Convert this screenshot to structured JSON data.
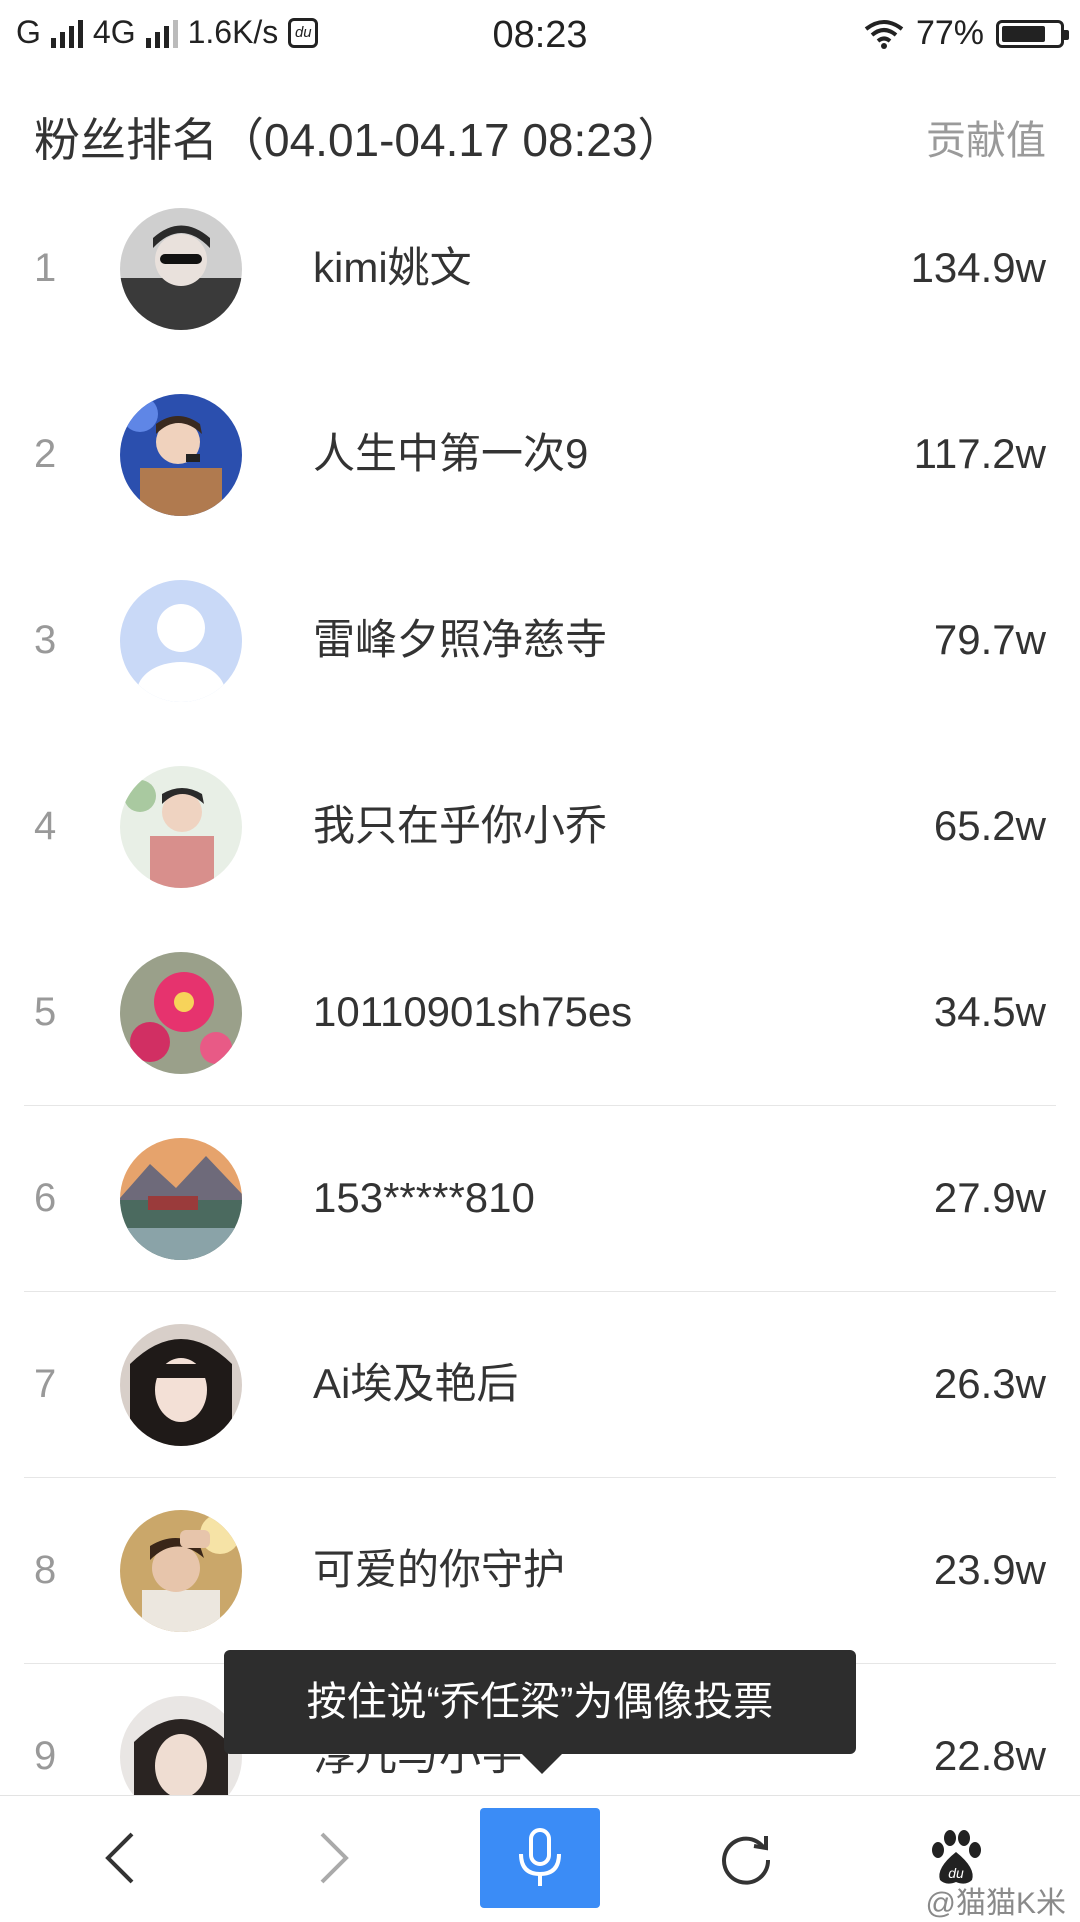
{
  "status_bar": {
    "carrier": "G",
    "network": "4G",
    "speed": "1.6K/s",
    "time": "08:23",
    "battery": "77%",
    "battery_level": 0.77
  },
  "header": {
    "title": "粉丝排名（04.01-04.17 08:23）",
    "column_label": "贡献值"
  },
  "fans": [
    {
      "rank": "1",
      "name": "kimi姚文",
      "score": "134.9w",
      "avatar": "photo-man-sunglasses"
    },
    {
      "rank": "2",
      "name": "人生中第一次9",
      "score": "117.2w",
      "avatar": "photo-singer-stage"
    },
    {
      "rank": "3",
      "name": "雷峰夕照净慈寺",
      "score": "79.7w",
      "avatar": "default-avatar"
    },
    {
      "rank": "4",
      "name": "我只在乎你小乔",
      "score": "65.2w",
      "avatar": "photo-man-pink-suit"
    },
    {
      "rank": "5",
      "name": "10110901sh75es",
      "score": "34.5w",
      "avatar": "photo-pink-flower"
    },
    {
      "rank": "6",
      "name": "153*****810",
      "score": "27.9w",
      "avatar": "photo-mountain-lake"
    },
    {
      "rank": "7",
      "name": "Ai埃及艳后",
      "score": "26.3w",
      "avatar": "photo-girl"
    },
    {
      "rank": "8",
      "name": "可爱的你守护",
      "score": "23.9w",
      "avatar": "photo-man-sun"
    },
    {
      "rank": "9",
      "name": "淳儿与小宇",
      "score": "22.8w",
      "avatar": "photo-woman"
    }
  ],
  "tooltip": {
    "text": "按住说“乔任梁”为偶像投票"
  },
  "toolbar": {
    "back_icon": "chevron-left-icon",
    "forward_icon": "chevron-right-icon",
    "mic_icon": "microphone-icon",
    "refresh_icon": "refresh-icon",
    "home_icon": "baidu-paw-icon",
    "accent": "#3b8cf6"
  },
  "watermark": {
    "text": "@猫猫K米"
  }
}
